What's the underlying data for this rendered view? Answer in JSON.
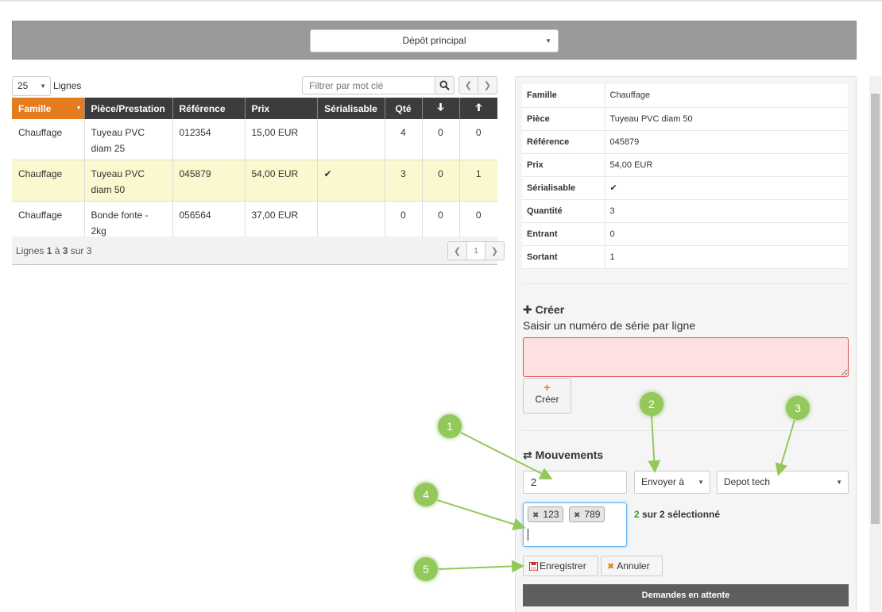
{
  "depot": {
    "selected": "Dépôt principal"
  },
  "table_controls": {
    "lines_value": "25",
    "lines_label": "Lignes",
    "filter_placeholder": "Filtrer par mot clé"
  },
  "table": {
    "columns": [
      "Famille",
      "Pièce/Prestation",
      "Référence",
      "Prix",
      "Sérialisable",
      "Qté",
      "↓",
      "↑"
    ],
    "rows": [
      {
        "famille": "Chauffage",
        "piece": "Tuyeau PVC diam 25",
        "reference": "012354",
        "prix": "15,00 EUR",
        "serialisable": "",
        "qte": "4",
        "entrant": "0",
        "sortant": "0"
      },
      {
        "famille": "Chauffage",
        "piece": "Tuyeau PVC diam 50",
        "reference": "045879",
        "prix": "54,00 EUR",
        "serialisable": "✔",
        "qte": "3",
        "entrant": "0",
        "sortant": "1"
      },
      {
        "famille": "Chauffage",
        "piece": "Bonde fonte - 2kg",
        "reference": "056564",
        "prix": "37,00 EUR",
        "serialisable": "",
        "qte": "0",
        "entrant": "0",
        "sortant": "0"
      }
    ],
    "footer": {
      "prefix": "Lignes ",
      "from": "1",
      "middle": " à ",
      "to": "3",
      "suffix": " sur 3",
      "page": "1"
    }
  },
  "details": {
    "rows": [
      {
        "label": "Famille",
        "value": "Chauffage"
      },
      {
        "label": "Pièce",
        "value": "Tuyeau PVC diam 50"
      },
      {
        "label": "Référence",
        "value": "045879"
      },
      {
        "label": "Prix",
        "value": "54,00 EUR"
      },
      {
        "label": "Sérialisable",
        "value": "✔"
      },
      {
        "label": "Quantité",
        "value": "3"
      },
      {
        "label": "Entrant",
        "value": "0"
      },
      {
        "label": "Sortant",
        "value": "1"
      }
    ]
  },
  "create": {
    "title": "Créer",
    "help": "Saisir un numéro de série par ligne",
    "button_label": "Créer"
  },
  "movements": {
    "title": "Mouvements",
    "quantity": "2",
    "action": "Envoyer à",
    "destination": "Depot tech",
    "tags": [
      "123",
      "789"
    ],
    "selected_count": "2",
    "selected_suffix": " sur 2 sélectionné",
    "save_label": "Enregistrer",
    "cancel_label": "Annuler"
  },
  "pending": {
    "label": "Demandes en attente"
  },
  "annotations": [
    "1",
    "2",
    "3",
    "4",
    "5"
  ],
  "colors": {
    "accent": "#e47c1f",
    "header": "#3c3c3c",
    "selected_row": "#f9f8cf",
    "marker": "#93c85a",
    "error_bg": "#fde0e0"
  }
}
